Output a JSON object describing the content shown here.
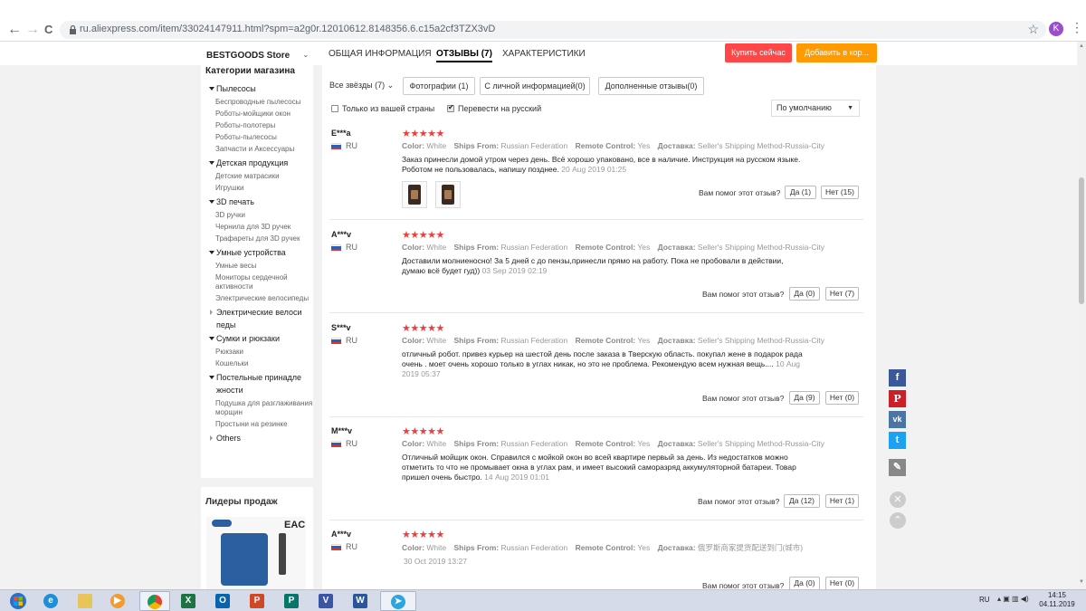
{
  "browser": {
    "back": "←",
    "forward": "→",
    "reload": "C",
    "url": "ru.aliexpress.com/item/33024147911.html?spm=a2g0r.12010612.8148356.6.c15a2cf3TZX3vD",
    "profile_letter": "K"
  },
  "store": {
    "name": "BESTGOODS Store",
    "tabs": [
      "ОБЩАЯ ИНФОРМАЦИЯ",
      "ОТЗЫВЫ (7)",
      "ХАРАКТЕРИСТИКИ"
    ],
    "buy_now": "Купить сейчас",
    "add_to_cart": "Добавить в кор..."
  },
  "sidebar": {
    "title": "Категории магазина",
    "groups": [
      {
        "head": "Пылесосы",
        "subs": [
          "Беспроводные пылесосы",
          "Роботы-мойщики окон",
          "Роботы-полотеры",
          "Роботы-пылесосы",
          "Запчасти и Аксессуары"
        ]
      },
      {
        "head": "Детская продукция",
        "subs": [
          "Детские матрасики",
          "Игрушки"
        ]
      },
      {
        "head": "3D печать",
        "subs": [
          "3D ручки",
          "Чернила для 3D ручек",
          "Трафареты для 3D ручек"
        ]
      },
      {
        "head": "Умные устройства",
        "subs": [
          "Умные весы",
          "Мониторы сердечной активности",
          "Электрические велосипеды"
        ]
      },
      {
        "head": "Электрические велоси педы",
        "subs": []
      },
      {
        "head": "Сумки и рюкзаки",
        "subs": [
          "Рюкзаки",
          "Кошельки"
        ]
      },
      {
        "head": "Постельные принадле жности",
        "subs": [
          "Подушка для разглаживания морщин",
          "Простыни на резинке"
        ]
      },
      {
        "head": "Others",
        "subs": []
      }
    ],
    "leaders_title": "Лидеры продаж",
    "product_mark": "EAC"
  },
  "filters": {
    "all_stars": "Все звёзды (7)",
    "photos": "Фотографии (1)",
    "personal": "С личной информацией(0)",
    "extra": "Дополненные отзывы(0)",
    "only_country": "Только из вашей страны",
    "translate": "Перевести на русский",
    "sort": "По умолчанию"
  },
  "review_labels": {
    "helpful": "Вам помог этот отзыв?",
    "color": "Color:",
    "ships": "Ships From:",
    "remote": "Remote Control:",
    "delivery": "Доставка:",
    "country": "RU"
  },
  "reviews": [
    {
      "name": "E***a",
      "stars": "★★★★★",
      "color": "White",
      "ships": "Russian Federation",
      "remote": "Yes",
      "delivery": "Seller's Shipping Method-Russia-City",
      "text": "Заказ принесли домой утром через день. Всё хорошо упаковано, все в наличие. Инструкция на русском языке. Роботом не пользовалась, напишу позднее.",
      "date": "20 Aug 2019 01:25",
      "yes": "Да (1)",
      "no": "Нет (15)"
    },
    {
      "name": "A***v",
      "stars": "★★★★★",
      "color": "White",
      "ships": "Russian Federation",
      "remote": "Yes",
      "delivery": "Seller's Shipping Method-Russia-City",
      "text": "Доставили молниеносно! За 5 дней с до пензы,принесли прямо на работу. Пока не пробовали в действии, думаю всё будет гуд))",
      "date": "03 Sep 2019 02:19",
      "yes": "Да (0)",
      "no": "Нет (7)"
    },
    {
      "name": "S***v",
      "stars": "★★★★★",
      "color": "White",
      "ships": "Russian Federation",
      "remote": "Yes",
      "delivery": "Seller's Shipping Method-Russia-City",
      "text": "отличный робот. привез курьер на шестой день после заказа в Тверскую область. покупал жене в подарок рада очень . моет очень хорошо только в углах никак, но это не проблема. Рекомендую всем нужная вещь....",
      "date": "10 Aug 2019 05:37",
      "yes": "Да (9)",
      "no": "Нет (0)"
    },
    {
      "name": "M***v",
      "stars": "★★★★★",
      "color": "White",
      "ships": "Russian Federation",
      "remote": "Yes",
      "delivery": "Seller's Shipping Method-Russia-City",
      "text": "Отличный мойщик окон. Справился с мойкой окон во всей квартире первый за день. Из недостатков можно отметить то что не промывает окна в углах рам, и имеет высокий саморазряд аккумуляторной батареи. Товар пришел очень быстро.",
      "date": "14 Aug 2019 01:01",
      "yes": "Да (12)",
      "no": "Нет (1)"
    },
    {
      "name": "A***v",
      "stars": "★★★★★",
      "color": "White",
      "ships": "Russian Federation",
      "remote": "Yes",
      "delivery": "俄罗斯商家提货配送到门(城市)",
      "text": "",
      "date": "30 Oct 2019 13:27",
      "yes": "Да (0)",
      "no": "Нет (0)"
    }
  ],
  "social": [
    "f",
    "P",
    "vk",
    "t",
    "✎"
  ],
  "taskbar": {
    "lang": "RU",
    "time": "14:15",
    "date": "04.11.2019"
  }
}
